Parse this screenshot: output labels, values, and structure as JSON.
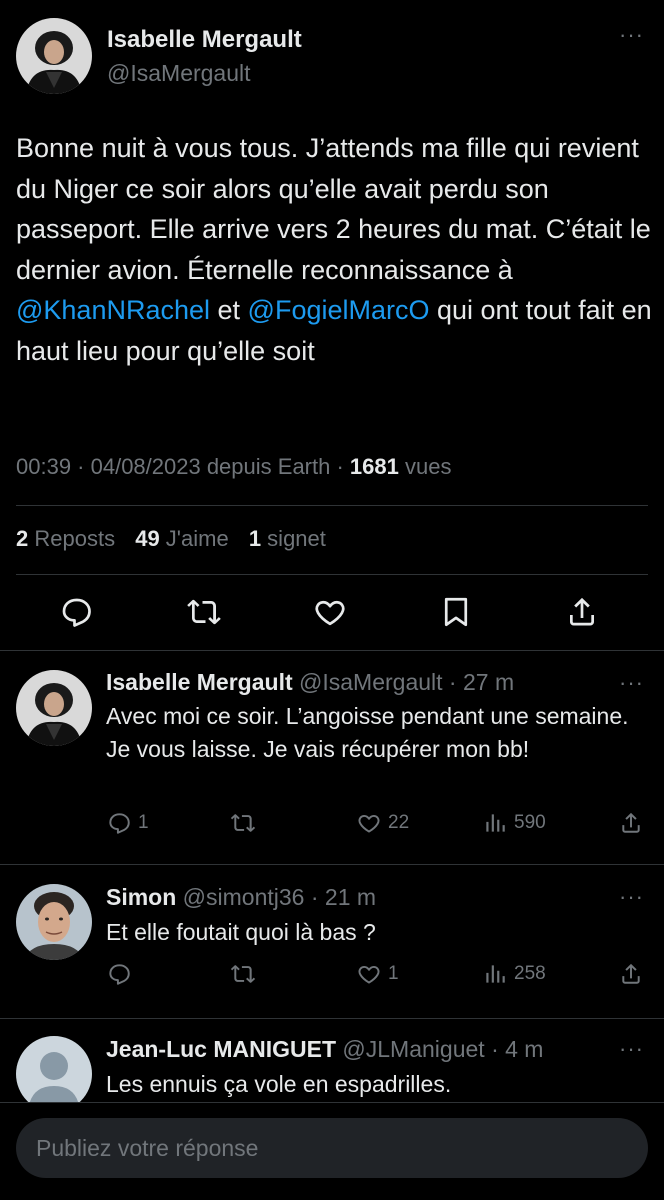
{
  "main_tweet": {
    "author_name": "Isabelle Mergault",
    "author_handle": "@IsaMergault",
    "more": "···",
    "text_part1": "Bonne nuit à vous tous. J’attends ma fille qui revient du Niger ce soir alors qu’elle avait perdu son passeport. Elle arrive vers 2 heures du mat. C’était le dernier avion. Éternelle reconnaissance à ",
    "mention1": "@KhanNRachel",
    "text_part2": " et ",
    "mention2": "@FogielMarcO",
    "text_part3": " qui ont tout fait en haut lieu pour qu’elle soit",
    "meta_time": "00:39 · 04/08/2023 depuis Earth · ",
    "views_count": "1681",
    "views_label": " vues",
    "reposts_count": "2",
    "reposts_label": " Reposts",
    "likes_count": "49",
    "likes_label": " J'aime",
    "bookmarks_count": "1",
    "bookmarks_label": " signet",
    "icons": [
      "reply-icon",
      "repost-icon",
      "like-icon",
      "bookmark-icon",
      "share-icon"
    ]
  },
  "replies": [
    {
      "author_name": "Isabelle Mergault",
      "author_handle": "@IsaMergault",
      "time": " · 27 m",
      "more": "···",
      "text": "Avec moi ce soir. L’angoisse pendant une semaine. Je vous laisse. Je vais récupérer mon bb!",
      "reply_count": "1",
      "repost_count": "",
      "like_count": "22",
      "view_count": "590"
    },
    {
      "author_name": "Simon",
      "author_handle": "@simontj36",
      "time": " · 21 m",
      "more": "···",
      "text": "Et elle foutait quoi là bas ?",
      "reply_count": "",
      "repost_count": "",
      "like_count": "1",
      "view_count": "258"
    },
    {
      "author_name": "Jean-Luc MANIGUET",
      "author_handle": "@JLManiguet",
      "time": " · 4 m",
      "more": "···",
      "text": "Les ennuis ça vole en espadrilles."
    }
  ],
  "compose": {
    "placeholder": "Publiez votre réponse"
  },
  "colors": {
    "background": "#000000",
    "text": "#e7e9ea",
    "secondary": "#71767b",
    "accent": "#1d9bf0",
    "divider": "#2f3336"
  }
}
